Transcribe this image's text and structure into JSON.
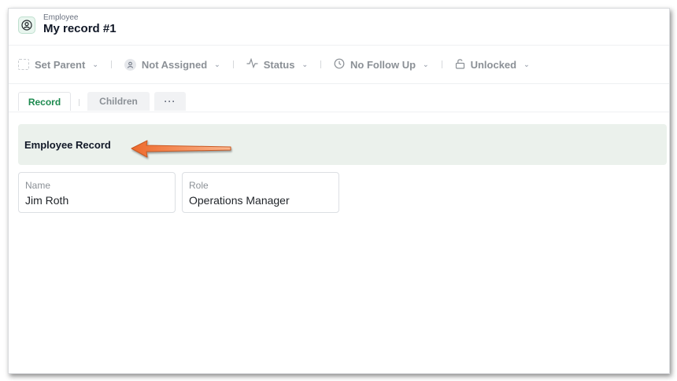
{
  "header": {
    "subtitle": "Employee",
    "title": "My record #1",
    "icon": "user-circle-icon"
  },
  "toolbar": {
    "set_parent": "Set Parent",
    "assignee": "Not Assigned",
    "status": "Status",
    "follow_up": "No Follow Up",
    "lock": "Unlocked"
  },
  "tabs": {
    "record": "Record",
    "children": "Children",
    "more": "···"
  },
  "section": {
    "title": "Employee Record",
    "bg_color": "#ebf1ec",
    "arrow_color": "#f07a3c"
  },
  "fields": {
    "name": {
      "label": "Name",
      "value": "Jim Roth"
    },
    "role": {
      "label": "Role",
      "value": "Operations Manager"
    }
  },
  "colors": {
    "accent": "#1d8a4f",
    "muted_text": "#8b9096"
  }
}
